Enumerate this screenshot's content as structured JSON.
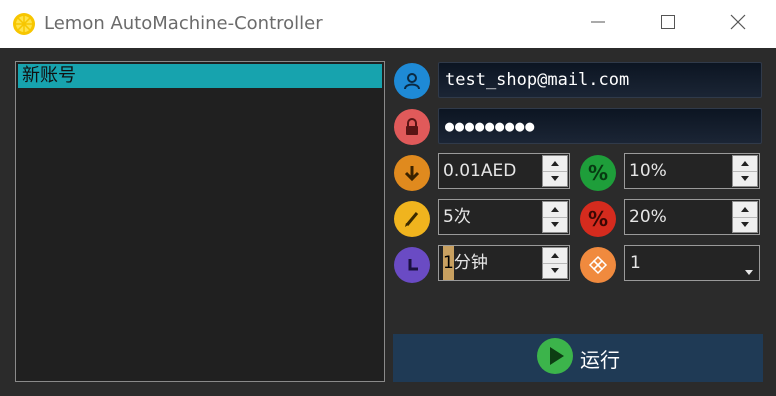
{
  "window": {
    "title": "Lemon AutoMachine-Controller",
    "icon": "lemon-icon",
    "controls": [
      "minimize-icon",
      "maximize-icon",
      "close-icon"
    ]
  },
  "accounts": {
    "items": [
      {
        "label": "新账号",
        "selected": true
      }
    ]
  },
  "form": {
    "username": {
      "value": "test_shop@mail.com",
      "icon": "user-icon",
      "icon_color": "#1e8ad6"
    },
    "password": {
      "value": "●●●●●●●●●",
      "icon": "lock-icon",
      "icon_color": "#e05a5a"
    },
    "amount": {
      "value": "0.01AED",
      "icon": "arrow-down-icon",
      "icon_color": "#e08a1e"
    },
    "percent1": {
      "value": "10%",
      "icon": "percent-icon",
      "icon_color": "#1e9e3a"
    },
    "count": {
      "value": "5次",
      "icon": "pencil-icon",
      "icon_color": "#f0b41e"
    },
    "percent2": {
      "value": "20%",
      "icon": "percent-icon",
      "icon_color": "#d52b1e"
    },
    "interval": {
      "cursor_char": "1",
      "rest": "分钟",
      "icon": "clock-icon",
      "icon_color": "#6a4bc4"
    },
    "threads": {
      "value": "1",
      "icon": "diamond-icon",
      "icon_color": "#f08a3e"
    }
  },
  "run_button": {
    "label": "运行",
    "icon": "play-icon",
    "icon_color": "#3cb44b"
  }
}
